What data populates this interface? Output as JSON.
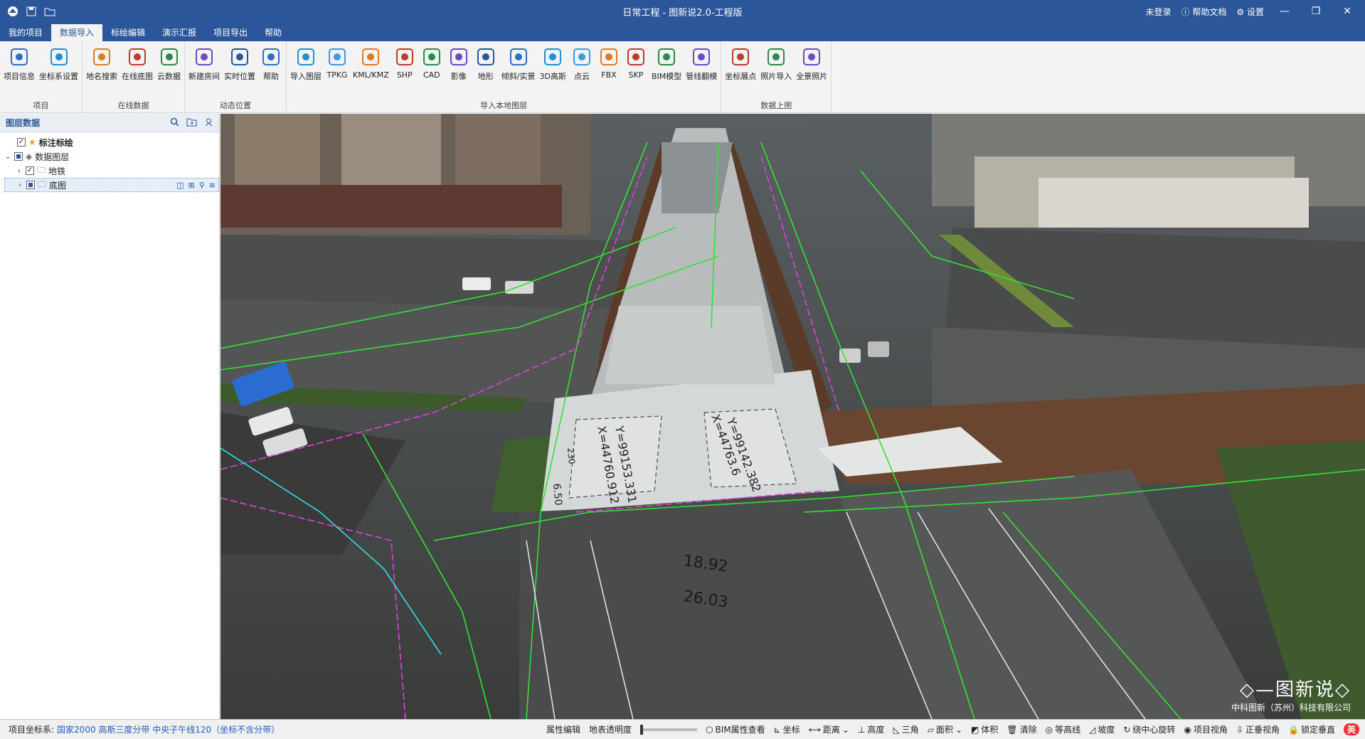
{
  "window": {
    "title": "日常工程 - 图新说2.0-工程版",
    "login": "未登录",
    "help_doc": "帮助文档",
    "settings": "设置"
  },
  "menu": [
    "我的项目",
    "数据导入",
    "标绘编辑",
    "演示汇报",
    "项目导出",
    "帮助"
  ],
  "ribbon": {
    "groups": [
      {
        "label": "项目",
        "tools": [
          {
            "label": "项目信息",
            "icon": "project-info-icon"
          },
          {
            "label": "坐标系设置",
            "icon": "coordinate-icon"
          }
        ]
      },
      {
        "label": "在线数据",
        "tools": [
          {
            "label": "地名搜索",
            "icon": "place-search-icon"
          },
          {
            "label": "在线底图",
            "icon": "globe-icon"
          },
          {
            "label": "云数据",
            "icon": "cloud-icon"
          }
        ]
      },
      {
        "label": "动态位置",
        "tools": [
          {
            "label": "新建房间",
            "icon": "new-room-icon"
          },
          {
            "label": "实时位置",
            "icon": "realtime-location-icon"
          },
          {
            "label": "帮助",
            "icon": "help-doc-icon"
          }
        ]
      },
      {
        "label": "导入本地图层",
        "tools": [
          {
            "label": "导入图层",
            "icon": "import-layer-icon"
          },
          {
            "label": "TPKG",
            "icon": "tpkg-icon"
          },
          {
            "label": "KML/KMZ",
            "icon": "kml-icon"
          },
          {
            "label": "SHP",
            "icon": "shp-icon"
          },
          {
            "label": "CAD",
            "icon": "cad-icon"
          },
          {
            "label": "影像",
            "icon": "imagery-icon"
          },
          {
            "label": "地形",
            "icon": "terrain-icon"
          },
          {
            "label": "倾斜/实景",
            "icon": "oblique-icon"
          },
          {
            "label": "3D高斯",
            "icon": "gaussian-icon"
          },
          {
            "label": "点云",
            "icon": "pointcloud-icon"
          },
          {
            "label": "FBX",
            "icon": "fbx-icon"
          },
          {
            "label": "SKP",
            "icon": "skp-icon"
          },
          {
            "label": "BIM模型",
            "icon": "bim-icon"
          },
          {
            "label": "管线翻模",
            "icon": "pipeline-icon"
          }
        ]
      },
      {
        "label": "数据上图",
        "tools": [
          {
            "label": "坐标展点",
            "icon": "coord-points-icon"
          },
          {
            "label": "照片导入",
            "icon": "photo-import-icon"
          },
          {
            "label": "全景照片",
            "icon": "panorama-icon"
          }
        ]
      }
    ]
  },
  "panel": {
    "title": "图层数据",
    "tree": [
      {
        "label": "标注标绘",
        "level": 0
      },
      {
        "label": "数据图层",
        "level": 0
      },
      {
        "label": "地铁",
        "level": 1
      },
      {
        "label": "底图",
        "level": 1
      }
    ]
  },
  "status": {
    "crs_label": "项目坐标系:",
    "crs_value": "国家2000 高斯三度分带 中央子午线120（坐标不含分带）",
    "items": [
      "属性编辑",
      "地表透明度",
      "BIM属性查看",
      "坐标",
      "距离",
      "高度",
      "三角",
      "面积",
      "体积",
      "清除",
      "等高线",
      "坡度",
      "绕中心旋转",
      "项目视角",
      "正垂视角",
      "锁定垂直"
    ],
    "ime": "英"
  },
  "viewport": {
    "labels": [
      "18.92",
      "26.03",
      "X=44760.912",
      "Y=99153.331",
      "X=44763.6",
      "Y=99142.382",
      "230",
      "6.50"
    ],
    "watermark_title": "图新说",
    "watermark_sub": "中科图新（苏州）科技有限公司"
  }
}
